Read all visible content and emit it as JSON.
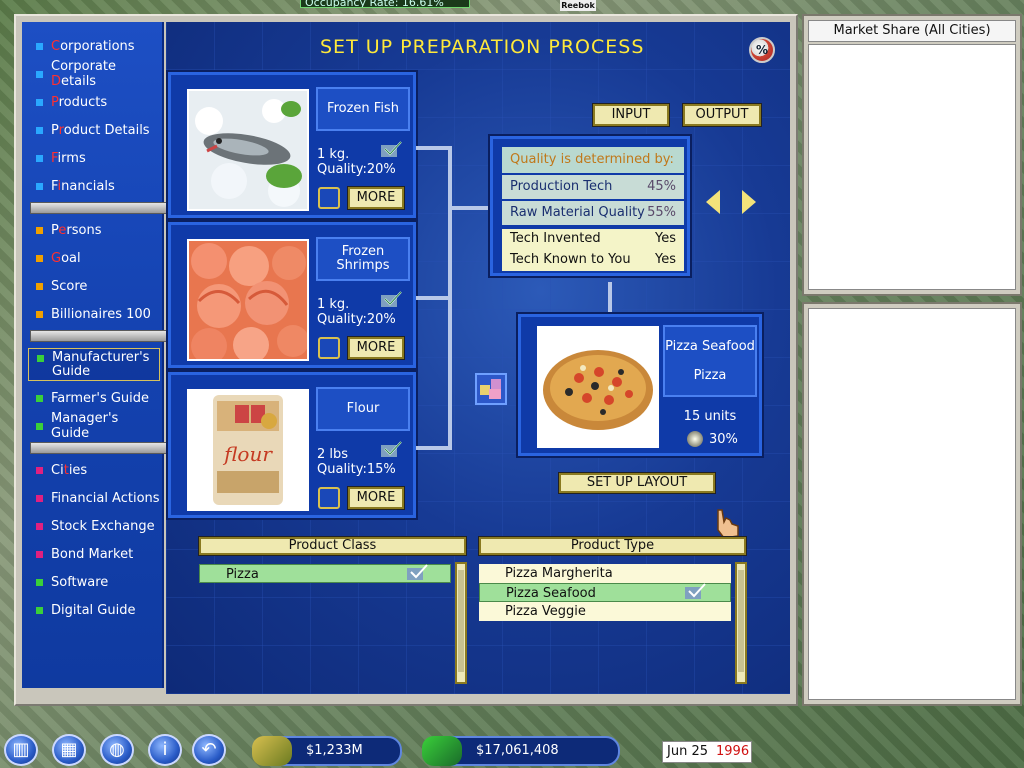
{
  "top": {
    "occupancy_text": "Occupancy Rate: 16.61%",
    "billboard": "Reebok"
  },
  "sidebar": {
    "items": [
      {
        "pre": "",
        "red": "C",
        "post": "orporations",
        "dot": "#2aa8ff"
      },
      {
        "pre": "Corporate ",
        "red": "D",
        "post": "etails",
        "dot": "#2aa8ff"
      },
      {
        "pre": "",
        "red": "P",
        "post": "roducts",
        "dot": "#2aa8ff"
      },
      {
        "pre": "P",
        "red": "r",
        "post": "oduct Details",
        "dot": "#2aa8ff"
      },
      {
        "pre": "",
        "red": "F",
        "post": "irms",
        "dot": "#2aa8ff"
      },
      {
        "pre": "F",
        "red": "i",
        "post": "nancials",
        "dot": "#2aa8ff"
      },
      {
        "pre": "P",
        "red": "e",
        "post": "rsons",
        "dot": "#f0a000"
      },
      {
        "pre": "",
        "red": "G",
        "post": "oal",
        "dot": "#f0a000"
      },
      {
        "pre": "Score",
        "red": "",
        "post": "",
        "dot": "#f0a000"
      },
      {
        "pre": "Billionaires 100",
        "red": "",
        "post": "",
        "dot": "#f0a000"
      },
      {
        "pre": "Manufacturer's Guide",
        "red": "",
        "post": "",
        "dot": "#3ad03a"
      },
      {
        "pre": "Farmer's Guide",
        "red": "",
        "post": "",
        "dot": "#3ad03a"
      },
      {
        "pre": "Manager's Guide",
        "red": "",
        "post": "",
        "dot": "#3ad03a"
      },
      {
        "pre": "Ci",
        "red": "t",
        "post": "ies",
        "dot": "#e02080"
      },
      {
        "pre": "Financial Actions",
        "red": "",
        "post": "",
        "dot": "#e02080"
      },
      {
        "pre": "Stock Exchange",
        "red": "",
        "post": "",
        "dot": "#e02080"
      },
      {
        "pre": "Bond Market",
        "red": "",
        "post": "",
        "dot": "#e02080"
      },
      {
        "pre": "Software",
        "red": "",
        "post": "",
        "dot": "#3ad03a"
      },
      {
        "pre": "Digital Guide",
        "red": "",
        "post": "",
        "dot": "#3ad03a"
      }
    ]
  },
  "panel": {
    "title": "SET UP PREPARATION PROCESS",
    "pct_icon": "%",
    "input_label": "INPUT",
    "output_label": "OUTPUT",
    "ingredients": [
      {
        "name": "Frozen Fish",
        "qty": "1 kg.",
        "quality": "Quality:20%",
        "more": "MORE",
        "icon": "fish-photo"
      },
      {
        "name": "Frozen Shrimps",
        "qty": "1 kg.",
        "quality": "Quality:20%",
        "more": "MORE",
        "icon": "shrimp-photo"
      },
      {
        "name": "Flour",
        "qty": "2 lbs",
        "quality": "Quality:15%",
        "more": "MORE",
        "icon": "flour-photo"
      }
    ],
    "quality": {
      "heading": "Quality is determined by:",
      "rows": [
        {
          "label": "Production Tech",
          "value": "45%"
        },
        {
          "label": "Raw Material Quality",
          "value": "55%"
        },
        {
          "label": "Tech Invented",
          "value": "Yes"
        },
        {
          "label": "Tech Known to You",
          "value": "Yes"
        }
      ]
    },
    "output": {
      "name": "Pizza Seafood",
      "category": "Pizza",
      "units": "15 units",
      "share": "30%"
    },
    "layout_button": "SET UP LAYOUT",
    "product_class": {
      "header": "Product Class",
      "items": [
        "Pizza"
      ],
      "selected": "Pizza"
    },
    "product_type": {
      "header": "Product Type",
      "items": [
        "Pizza Margherita",
        "Pizza Seafood",
        "Pizza Veggie"
      ],
      "selected": "Pizza Seafood"
    }
  },
  "market_share": {
    "title": "Market Share (All Cities)"
  },
  "bottom": {
    "cash": "$1,233M",
    "net": "$17,061,408",
    "date_month_day": "Jun 25",
    "date_year": "1996"
  },
  "colors": {
    "title_yellow": "#ffe93a",
    "panel_blue": "#0f3aa8",
    "button_cream": "#efe9b0",
    "selected_green": "#9fe09a",
    "year_red": "#d01010"
  }
}
